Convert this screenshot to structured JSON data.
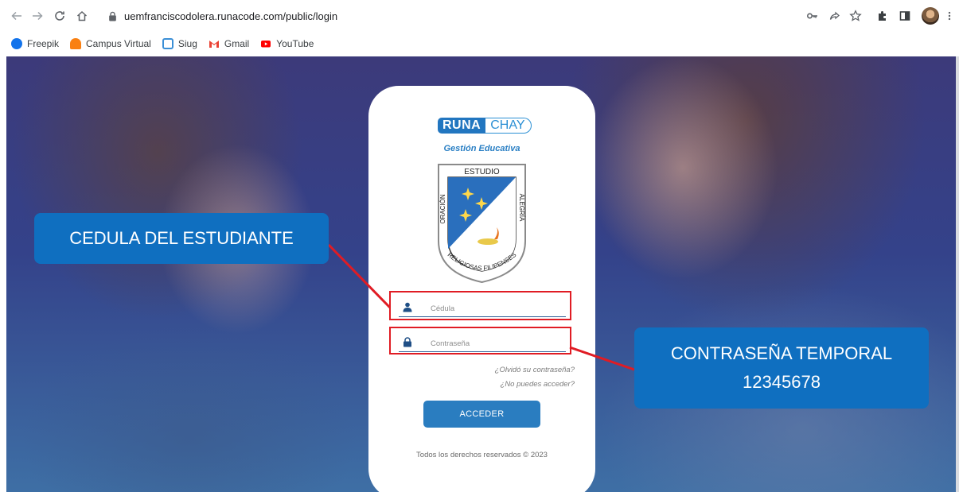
{
  "browser": {
    "url": "uemfranciscodolera.runacode.com/public/login",
    "bookmarks": [
      {
        "label": "Freepik",
        "icon": "freepik-icon",
        "color": "#1273eb"
      },
      {
        "label": "Campus Virtual",
        "icon": "moodle-icon",
        "color": "#f98012"
      },
      {
        "label": "Siug",
        "icon": "siug-icon",
        "color": "#3b8fd6"
      },
      {
        "label": "Gmail",
        "icon": "gmail-icon",
        "color": "#ea4335"
      },
      {
        "label": "YouTube",
        "icon": "youtube-icon",
        "color": "#ff0000"
      }
    ]
  },
  "login": {
    "logo_part1": "RUNA",
    "logo_part2": "CHAY",
    "subtitle": "Gestión Educativa",
    "crest": {
      "top": "ESTUDIO",
      "left": "ORACIÓN",
      "right": "ALEGRÍA",
      "bottom": "RELIGIOSAS FILIPENSES"
    },
    "cedula_placeholder": "Cédula",
    "password_placeholder": "Contraseña",
    "forgot_link": "¿Olvidó su contraseña?",
    "cant_access_link": "¿No puedes acceder?",
    "submit_label": "ACCEDER",
    "footer": "Todos los derechos reservados © 2023"
  },
  "annotations": {
    "left_callout": "CEDULA DEL ESTUDIANTE",
    "right_callout_line1": "CONTRASEÑA TEMPORAL",
    "right_callout_line2": "12345678"
  },
  "colors": {
    "accent": "#2a7dc0",
    "callout": "#0f6fc0",
    "highlight": "#e01c24"
  }
}
